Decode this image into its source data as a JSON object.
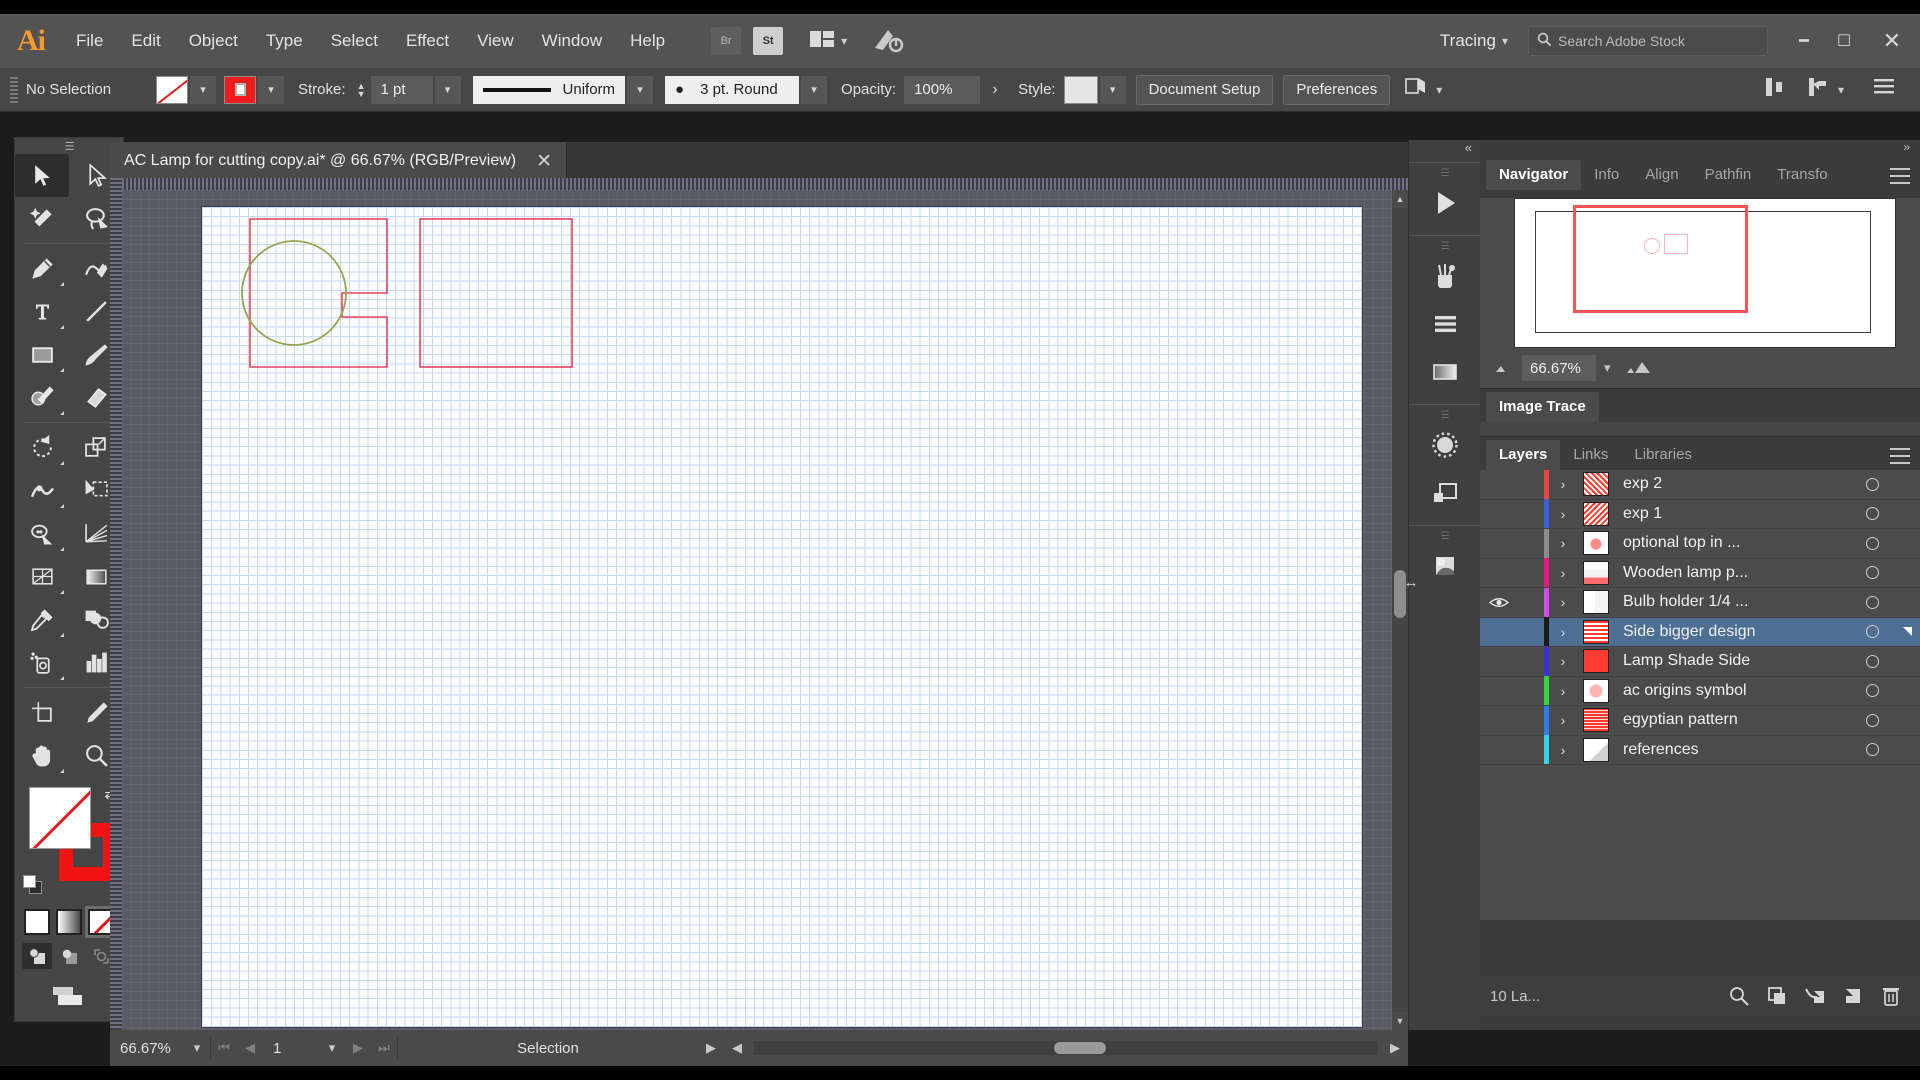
{
  "app": {
    "name": "Adobe Illustrator",
    "logo": "Ai"
  },
  "menubar": {
    "items": [
      "File",
      "Edit",
      "Object",
      "Type",
      "Select",
      "Effect",
      "View",
      "Window",
      "Help"
    ],
    "bridge_label": "Br",
    "stock_label": "St",
    "arrange_icon": "arrange-documents-icon",
    "workspace": "Tracing",
    "search_placeholder": "Search Adobe Stock",
    "window_minimize": "minimize-icon",
    "window_restore": "restore-icon",
    "window_close": "close-icon"
  },
  "controlbar": {
    "selection_status": "No Selection",
    "fill_swatch": "none-fill-swatch",
    "stroke_swatch": "red-stroke-swatch",
    "stroke_label": "Stroke:",
    "stroke_weight": "1 pt",
    "variable_width_profile": "Uniform",
    "brush_definition": "3 pt. Round",
    "opacity_label": "Opacity:",
    "opacity_value": "100%",
    "opacity_more": "›",
    "style_label": "Style:",
    "document_setup": "Document Setup",
    "preferences": "Preferences",
    "align_icon": "align-icon",
    "transform_icon": "transform-icon",
    "more_options_icon": "panel-menu-icon"
  },
  "document": {
    "tab_title": "AC Lamp for cutting copy.ai* @ 66.67% (RGB/Preview)",
    "close_icon": "close-tab-icon"
  },
  "tools": [
    {
      "name": "selection-tool",
      "icon": "arrow-solid",
      "selected": true
    },
    {
      "name": "direct-selection-tool",
      "icon": "arrow-hollow",
      "selected": false
    },
    {
      "name": "magic-wand-tool",
      "icon": "magic-wand",
      "selected": false
    },
    {
      "name": "lasso-tool",
      "icon": "lasso",
      "selected": false
    },
    {
      "name": "pen-tool",
      "icon": "pen",
      "selected": false
    },
    {
      "name": "curvature-tool",
      "icon": "curvature",
      "selected": false
    },
    {
      "name": "type-tool",
      "icon": "type-T",
      "selected": false
    },
    {
      "name": "line-segment-tool",
      "icon": "line",
      "selected": false
    },
    {
      "name": "rectangle-tool",
      "icon": "rectangle",
      "selected": false
    },
    {
      "name": "paintbrush-tool",
      "icon": "paintbrush",
      "selected": false
    },
    {
      "name": "shaper-tool",
      "icon": "shaper-pencil",
      "selected": false
    },
    {
      "name": "eraser-tool",
      "icon": "eraser",
      "selected": false
    },
    {
      "name": "rotate-tool",
      "icon": "rotate",
      "selected": false
    },
    {
      "name": "scale-tool",
      "icon": "scale",
      "selected": false
    },
    {
      "name": "width-tool",
      "icon": "width",
      "selected": false
    },
    {
      "name": "free-transform-tool",
      "icon": "free-transform",
      "selected": false
    },
    {
      "name": "shape-builder-tool",
      "icon": "shape-builder",
      "selected": false
    },
    {
      "name": "perspective-grid-tool",
      "icon": "perspective-grid",
      "selected": false
    },
    {
      "name": "mesh-tool",
      "icon": "mesh",
      "selected": false
    },
    {
      "name": "gradient-tool",
      "icon": "gradient",
      "selected": false
    },
    {
      "name": "eyedropper-tool",
      "icon": "eyedropper",
      "selected": false
    },
    {
      "name": "blend-tool",
      "icon": "blend",
      "selected": false
    },
    {
      "name": "symbol-sprayer-tool",
      "icon": "symbol-sprayer",
      "selected": false
    },
    {
      "name": "column-graph-tool",
      "icon": "bar-graph",
      "selected": false
    },
    {
      "name": "artboard-tool",
      "icon": "artboard",
      "selected": false
    },
    {
      "name": "slice-tool",
      "icon": "slice-knife",
      "selected": false
    },
    {
      "name": "hand-tool",
      "icon": "hand",
      "selected": false
    },
    {
      "name": "zoom-tool",
      "icon": "magnifier",
      "selected": false
    }
  ],
  "toolbar_bottom": {
    "fill_swatch": "fill-none-swatch",
    "stroke_swatch": "stroke-red-swatch",
    "swap_icon": "swap-fill-stroke-icon",
    "default_icon": "default-fill-stroke-icon",
    "fill_modes": [
      "color-mode",
      "gradient-mode",
      "none-mode"
    ],
    "draw_modes": [
      "draw-normal",
      "draw-behind",
      "draw-inside"
    ],
    "screen_mode": "change-screen-mode-icon"
  },
  "canvas": {
    "grid_visible": true,
    "artwork": [
      {
        "name": "side-panel-outline",
        "type": "path",
        "stroke": "#e8425a"
      },
      {
        "name": "circle-cutout",
        "type": "circle",
        "stroke": "#9aa84a"
      },
      {
        "name": "second-panel-outline",
        "type": "rect",
        "stroke": "#e8425a"
      }
    ]
  },
  "statusbar": {
    "zoom": "66.67%",
    "first_icon": "first-artboard-icon",
    "prev_icon": "prev-artboard-icon",
    "artboard_number": "1",
    "next_icon": "next-artboard-icon",
    "last_icon": "last-artboard-icon",
    "status_text": "Selection",
    "play_icon": "status-menu-icon"
  },
  "rail": {
    "collapse": "«",
    "icons": [
      "libraries-play-icon",
      "brushes-icon",
      "symbols-icon",
      "gradient-icon",
      "transparency-icon",
      "pathfinder-icon",
      "image-trace-icon"
    ]
  },
  "navigator_panel": {
    "tabs": [
      "Navigator",
      "Info",
      "Align",
      "Pathfin",
      "Transfo"
    ],
    "active_tab": "Navigator",
    "menu_icon": "panel-menu-icon",
    "zoom_out_icon": "zoom-out-mountain-icon",
    "zoom_value": "66.67%",
    "zoom_in_icon": "zoom-in-mountain-icon"
  },
  "image_trace_panel": {
    "tabs": [
      "Image Trace"
    ],
    "active_tab": "Image Trace"
  },
  "layers_panel": {
    "tabs": [
      "Layers",
      "Links",
      "Libraries"
    ],
    "active_tab": "Layers",
    "menu_icon": "panel-menu-icon",
    "layers": [
      {
        "name": "exp 2",
        "color": "#e8453c",
        "visible": false,
        "selected": false
      },
      {
        "name": "exp 1",
        "color": "#3b5fe0",
        "visible": false,
        "selected": false
      },
      {
        "name": "optional top in ...",
        "color": "#8c8c8c",
        "visible": false,
        "selected": false
      },
      {
        "name": "Wooden lamp p...",
        "color": "#e6187f",
        "visible": false,
        "selected": false
      },
      {
        "name": "Bulb holder 1/4 ...",
        "color": "#d24be8",
        "visible": true,
        "selected": false
      },
      {
        "name": "Side bigger design",
        "color": "#1a1a1a",
        "visible": false,
        "selected": true
      },
      {
        "name": "Lamp Shade Side",
        "color": "#3b2fe0",
        "visible": false,
        "selected": false
      },
      {
        "name": "ac origins symbol",
        "color": "#37d43c",
        "visible": false,
        "selected": false
      },
      {
        "name": "egyptian pattern",
        "color": "#2f7de8",
        "visible": false,
        "selected": false
      },
      {
        "name": "references",
        "color": "#2fd4e8",
        "visible": false,
        "selected": false
      }
    ],
    "footer_count": "10 La...",
    "footer_icons": [
      "locate-object-icon",
      "make-clipping-mask-icon",
      "create-new-sublayer-icon",
      "create-new-layer-icon",
      "delete-selection-icon"
    ]
  },
  "colors": {
    "accent_red": "#f01313",
    "selection_blue": "#4d6f94",
    "panel_bg": "#4b4b4b",
    "chrome_bg": "#535353"
  }
}
